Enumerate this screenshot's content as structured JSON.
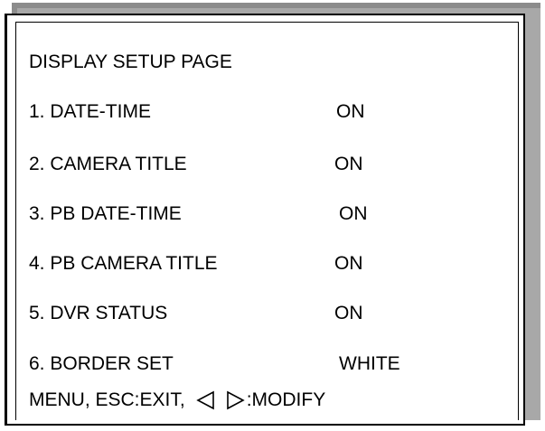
{
  "page": {
    "title": "DISPLAY SETUP PAGE"
  },
  "menu": {
    "items": [
      {
        "label": "1. DATE-TIME",
        "value": "ON"
      },
      {
        "label": "2. CAMERA TITLE",
        "value": "ON"
      },
      {
        "label": "3. PB DATE-TIME",
        "value": "ON"
      },
      {
        "label": "4. PB CAMERA TITLE",
        "value": "ON"
      },
      {
        "label": "5. DVR STATUS",
        "value": "ON"
      },
      {
        "label": "6. BORDER SET",
        "value": "WHITE"
      }
    ]
  },
  "footer": {
    "hint": "MENU, ESC:EXIT,",
    "left_icon": "left-triangle-icon",
    "right_icon": "right-triangle-icon",
    "modify": ":MODIFY"
  }
}
